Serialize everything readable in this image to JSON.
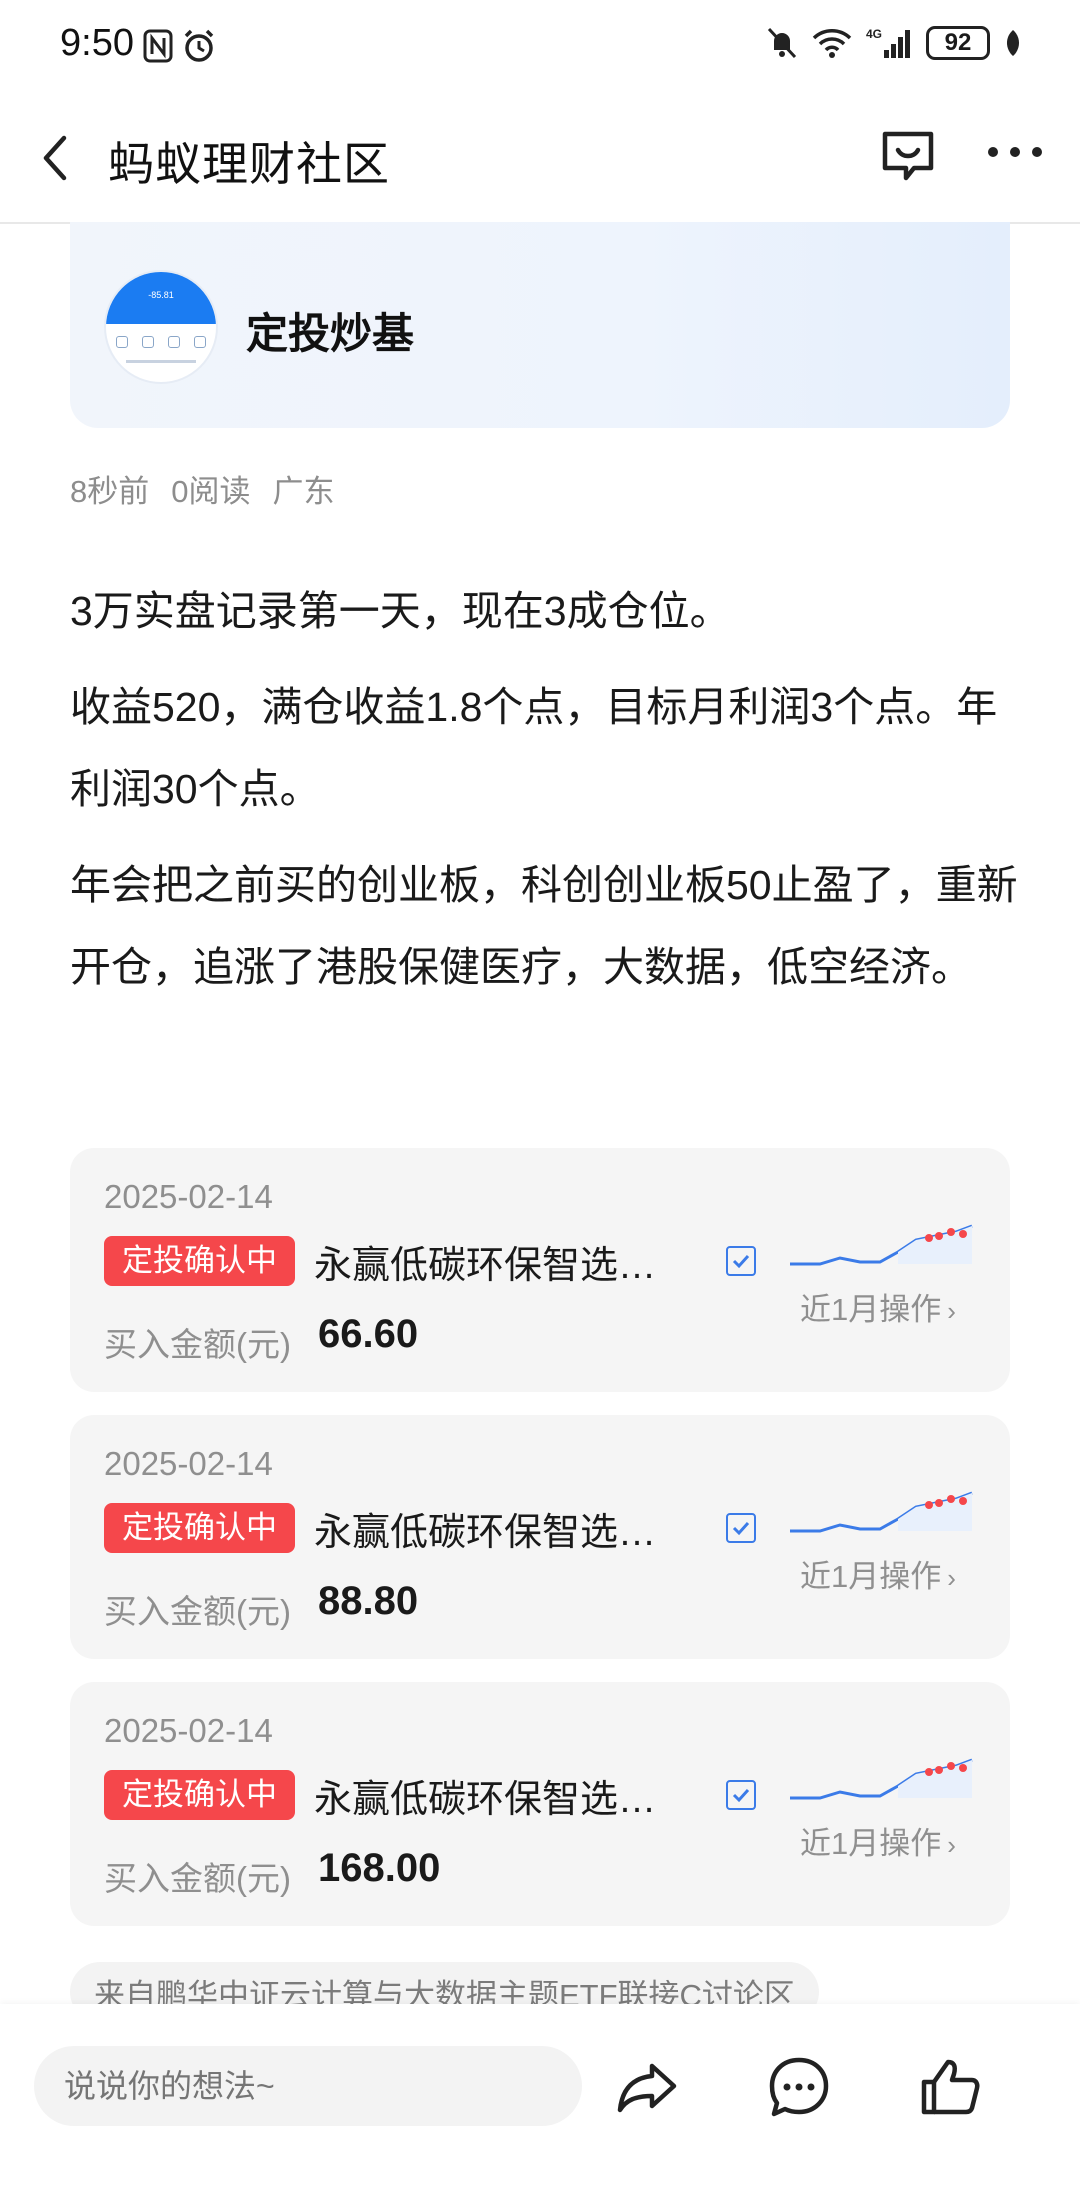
{
  "status_bar": {
    "time": "9:50",
    "battery": "92",
    "network": "4G"
  },
  "header": {
    "title": "蚂蚁理财社区",
    "icons": [
      "back-icon",
      "feedback-icon",
      "more-icon"
    ]
  },
  "topic": {
    "name": "定投炒基"
  },
  "meta": {
    "time": "8秒前",
    "reads": "0阅读",
    "location": "广东"
  },
  "post": {
    "paragraphs": [
      "3万实盘记录第一天，现在3成仓位。",
      "收益520，满仓收益1.8个点，目标月利润3个点。年利润30个点。",
      "年会把之前买的创业板，科创创业板50止盈了，重新开仓，追涨了港股保健医疗，大数据，低空经济。"
    ]
  },
  "holdings": [
    {
      "date": "2025-02-14",
      "status": "定投确认中",
      "fund": "永赢低碳环保智选…",
      "ops": "近1月操作",
      "amount_label": "买入金额(元)",
      "amount": "66.60"
    },
    {
      "date": "2025-02-14",
      "status": "定投确认中",
      "fund": "永赢低碳环保智选…",
      "ops": "近1月操作",
      "amount_label": "买入金额(元)",
      "amount": "88.80"
    },
    {
      "date": "2025-02-14",
      "status": "定投确认中",
      "fund": "永赢低碳环保智选…",
      "ops": "近1月操作",
      "amount_label": "买入金额(元)",
      "amount": "168.00"
    }
  ],
  "source": {
    "text": "来自鹏华中证云计算与大数据主题ETF联接C讨论区"
  },
  "bottom_bar": {
    "input_placeholder": "说说你的想法~",
    "icons": [
      "share-icon",
      "comment-icon",
      "like-icon"
    ]
  },
  "colors": {
    "status_red": "#f5474b",
    "accent_blue": "#3b7be8",
    "card_bg": "#f5f5f5"
  }
}
